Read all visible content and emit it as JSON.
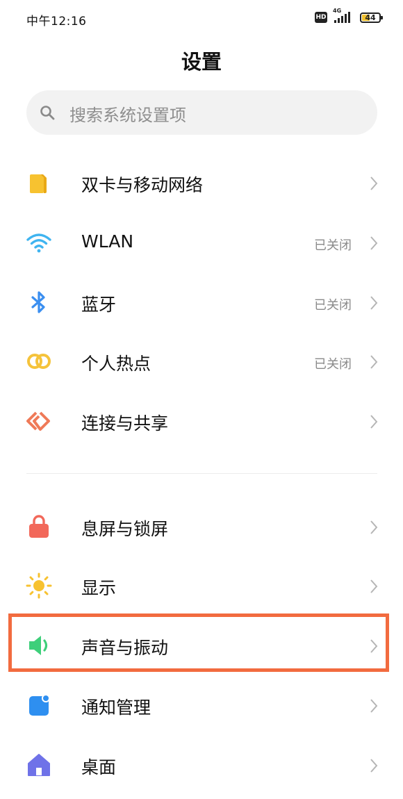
{
  "status_bar": {
    "time": "中午12:16",
    "hd": "HD",
    "network": "4G",
    "battery_level": "44"
  },
  "header": {
    "title": "设置"
  },
  "search": {
    "placeholder": "搜索系统设置项"
  },
  "settings": [
    {
      "label": "双卡与移动网络",
      "status": "",
      "icon": "sim-card-icon",
      "color": "#f7c230"
    },
    {
      "label": "WLAN",
      "status": "已关闭",
      "icon": "wifi-icon",
      "color": "#3fb4f0"
    },
    {
      "label": "蓝牙",
      "status": "已关闭",
      "icon": "bluetooth-icon",
      "color": "#3b8ff0"
    },
    {
      "label": "个人热点",
      "status": "已关闭",
      "icon": "hotspot-icon",
      "color": "#f5c33b"
    },
    {
      "label": "连接与共享",
      "status": "",
      "icon": "connection-share-icon",
      "color": "#ef7a58"
    },
    {
      "label": "息屏与锁屏",
      "status": "",
      "icon": "lock-icon",
      "color": "#f2685a"
    },
    {
      "label": "显示",
      "status": "",
      "icon": "display-sun-icon",
      "color": "#f7c230"
    },
    {
      "label": "声音与振动",
      "status": "",
      "icon": "speaker-icon",
      "color": "#3ecf7a"
    },
    {
      "label": "通知管理",
      "status": "",
      "icon": "notification-icon",
      "color": "#2e8ff0"
    },
    {
      "label": "桌面",
      "status": "",
      "icon": "home-icon",
      "color": "#6f72e8"
    }
  ],
  "highlight_color": "#f26b3f"
}
